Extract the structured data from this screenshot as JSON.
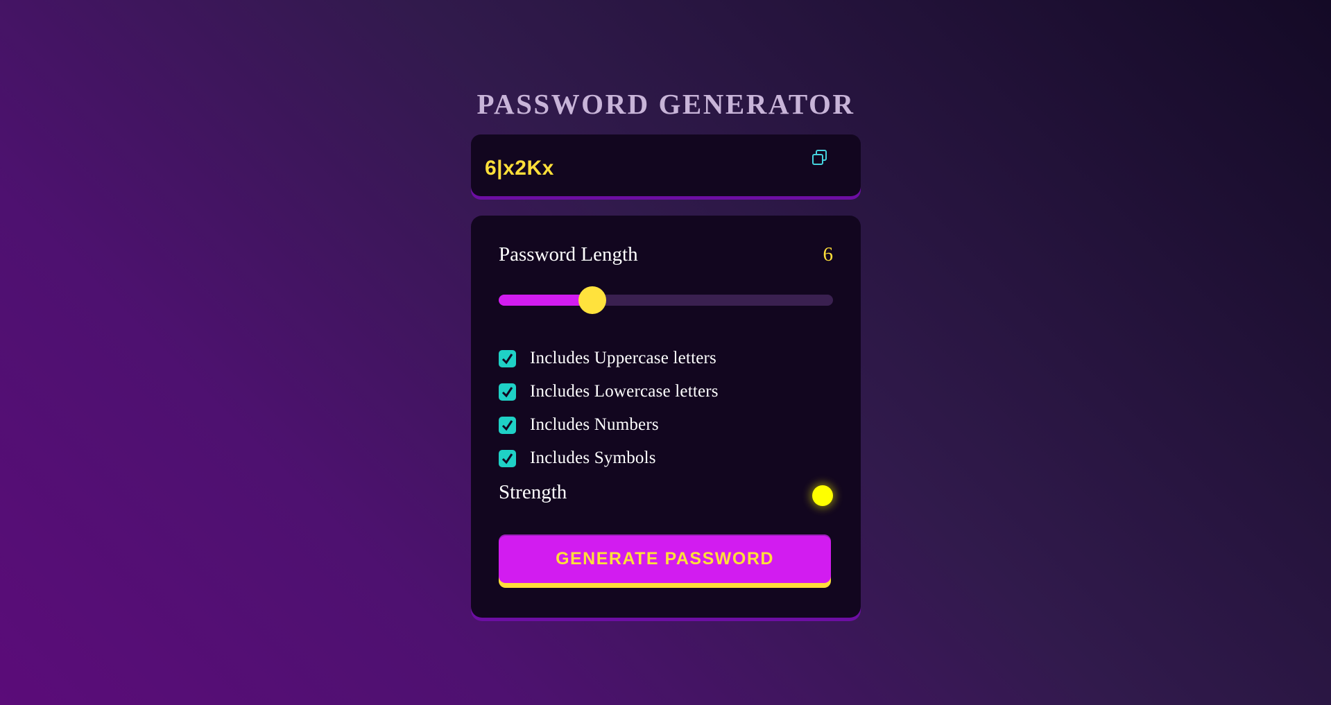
{
  "app": {
    "title": "PASSWORD GENERATOR"
  },
  "display": {
    "password": "6|x2Kx",
    "copy_icon": "copy-icon"
  },
  "length": {
    "label": "Password Length",
    "value": "6",
    "slider_fraction": 0.28
  },
  "options": [
    {
      "label": "Includes Uppercase letters",
      "checked": true
    },
    {
      "label": "Includes Lowercase letters",
      "checked": true
    },
    {
      "label": "Includes Numbers",
      "checked": true
    },
    {
      "label": "Includes Symbols",
      "checked": true
    }
  ],
  "strength": {
    "label": "Strength",
    "indicator_color": "#ffff00"
  },
  "generate": {
    "label": "GENERATE PASSWORD"
  },
  "colors": {
    "accent": "#d21cf0",
    "highlight": "#ffdf3a",
    "checkbox": "#1fd1c6",
    "panel": "#12061f"
  }
}
